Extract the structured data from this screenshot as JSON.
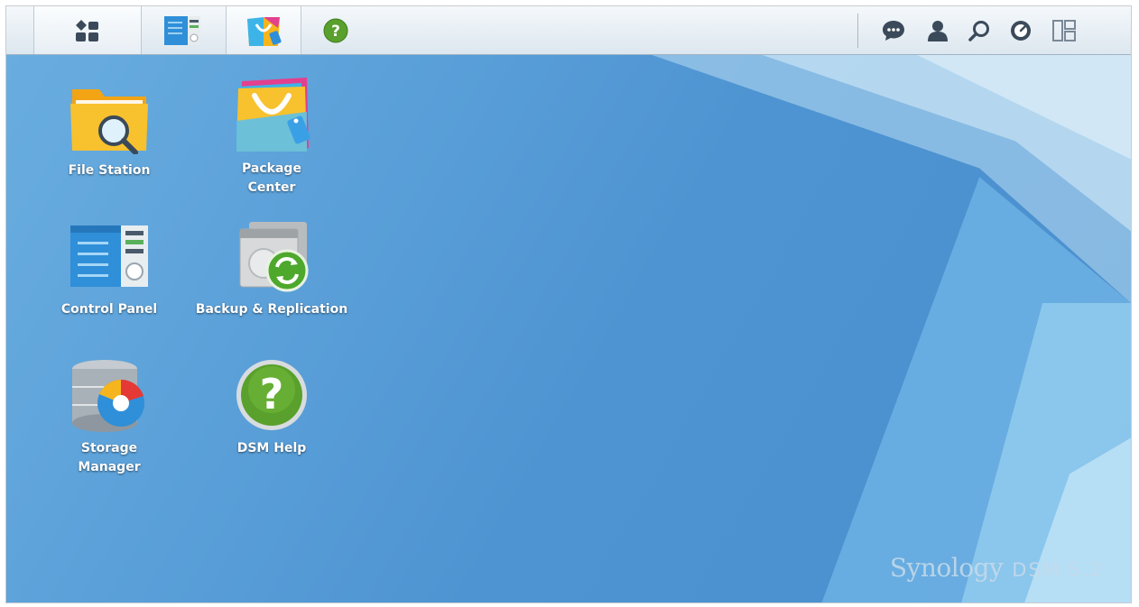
{
  "taskbar": {
    "left_buttons": [
      {
        "name": "main-menu-button",
        "icon": "main-menu-icon"
      },
      {
        "name": "taskbar-control-panel-button",
        "icon": "control-panel-icon"
      },
      {
        "name": "taskbar-package-center-button",
        "icon": "package-center-icon"
      },
      {
        "name": "taskbar-dsm-help-button",
        "icon": "help-icon"
      }
    ],
    "right_buttons": [
      {
        "name": "notifications-button",
        "icon": "chat-bubble-icon"
      },
      {
        "name": "user-options-button",
        "icon": "user-icon"
      },
      {
        "name": "search-button",
        "icon": "search-icon"
      },
      {
        "name": "resource-monitor-button",
        "icon": "gauge-icon"
      },
      {
        "name": "widgets-button",
        "icon": "widgets-icon"
      }
    ]
  },
  "desktop": {
    "icons": [
      {
        "label": "File Station",
        "icon": "file-station-icon"
      },
      {
        "label": "Package\nCenter",
        "icon": "package-center-icon"
      },
      {
        "label": "Control Panel",
        "icon": "control-panel-icon"
      },
      {
        "label": "Backup & Replication",
        "icon": "backup-replication-icon"
      },
      {
        "label": "Storage\nManager",
        "icon": "storage-manager-icon"
      },
      {
        "label": "DSM Help",
        "icon": "dsm-help-icon"
      }
    ]
  },
  "watermark": {
    "brand": "Synology",
    "product": "DSM 5.2"
  },
  "colors": {
    "desktop": "#5a9fd8",
    "taskbar": "#e8eef4",
    "help_green": "#5aa02c",
    "folder_yellow": "#f6b51c"
  }
}
